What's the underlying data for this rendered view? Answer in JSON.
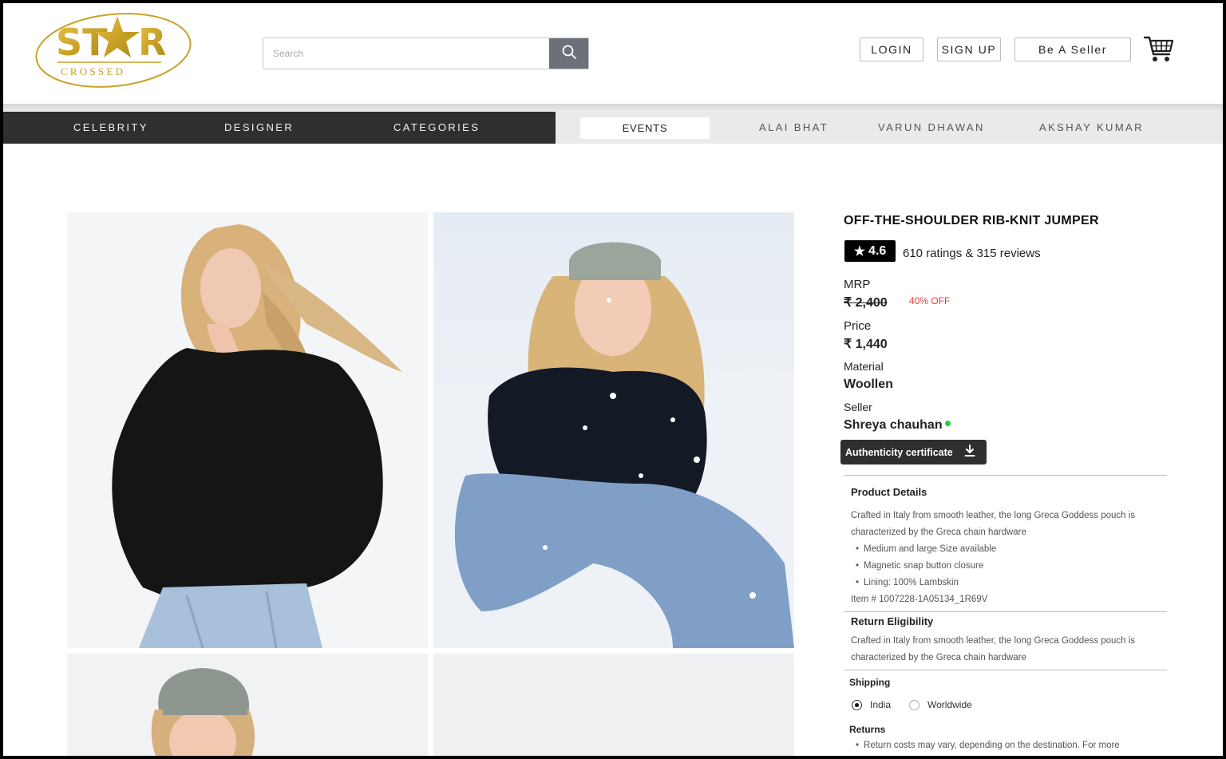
{
  "brand": {
    "logo_main": "ST★R",
    "logo_sub": "C R O S S E D",
    "gold": "#c9a227"
  },
  "search": {
    "placeholder": "Search",
    "icon": "search-icon"
  },
  "header": {
    "login_label": "LOGIN",
    "signup_label": "SIGN UP",
    "seller_label": "Be A Seller",
    "cart_icon": "cart-icon"
  },
  "nav": {
    "primary": [
      "CELEBRITY",
      "DESIGNER",
      "CATEGORIES"
    ],
    "active": "EVENTS",
    "secondary": [
      "ALAI BHAT",
      "VARUN DHAWAN",
      "AKSHAY KUMAR"
    ]
  },
  "product": {
    "title": "OFF-THE-SHOULDER RIB-KNIT JUMPER",
    "rating": "4.6",
    "rating_text": "610 ratings & 315 reviews",
    "mrp_label": "MRP",
    "mrp": "₹ 2,400",
    "discount": "40% OFF",
    "price_label": "Price",
    "price": "₹ 1,440",
    "material_label": "Material",
    "material": "Woollen",
    "seller_label": "Seller",
    "seller": "Shreya chauhan",
    "certificate_label": "Authenticity certificate",
    "download_icon": "download-icon"
  },
  "details": {
    "product_heading": "Product Details",
    "product_text": "Crafted in Italy from smooth leather, the long Greca Goddess pouch is characterized by the Greca chain hardware",
    "bullets": [
      "Medium and large Size available",
      "Magnetic snap button closure",
      "Lining: 100% Lambskin"
    ],
    "item_no": "Item # 1007228-1A05134_1R69V",
    "return_heading": "Return Eligibility",
    "return_text": "Crafted in Italy from smooth leather, the long Greca Goddess pouch is characterized by the Greca chain hardware",
    "shipping_heading": "Shipping",
    "shipping_options": [
      "India",
      "Worldwide"
    ],
    "shipping_selected": "India",
    "returns_heading": "Returns",
    "returns_text": "Return costs may vary, depending on the destination. For more"
  },
  "colors": {
    "nav_dark": "#2f2f2f",
    "nav_light": "#eaeaea",
    "discount": "#e23b3b",
    "online": "#2ecc40"
  }
}
